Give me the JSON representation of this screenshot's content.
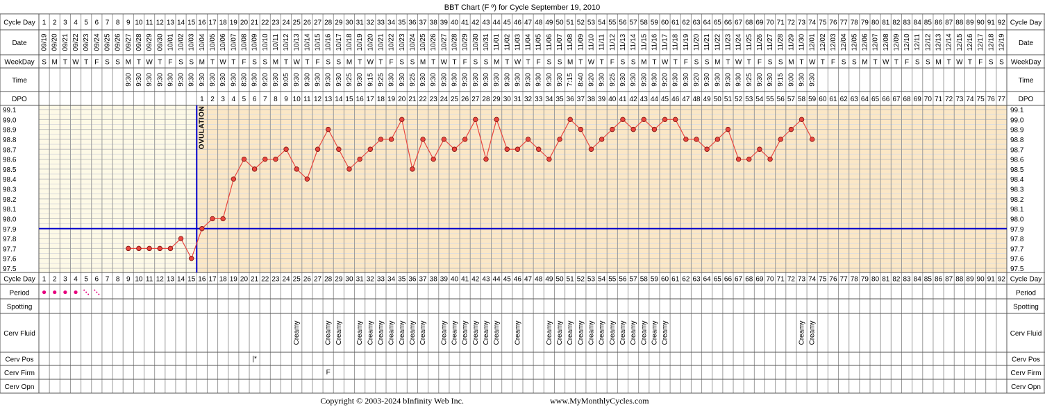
{
  "chart_data": {
    "type": "line",
    "title": "BBT Chart (F º) for Cycle September 19, 2010",
    "row_labels": {
      "cycle_day": "Cycle Day",
      "date": "Date",
      "weekday": "WeekDay",
      "time": "Time",
      "dpo": "DPO",
      "period": "Period",
      "spotting": "Spotting",
      "cerv_fluid": "Cerv Fluid",
      "cerv_pos": "Cerv Pos",
      "cerv_firm": "Cerv Firm",
      "cerv_opn": "Cerv Opn"
    },
    "cycle_days": [
      1,
      2,
      3,
      4,
      5,
      6,
      7,
      8,
      9,
      10,
      11,
      12,
      13,
      14,
      15,
      16,
      17,
      18,
      19,
      20,
      21,
      22,
      23,
      24,
      25,
      26,
      27,
      28,
      29,
      30,
      31,
      32,
      33,
      34,
      35,
      36,
      37,
      38,
      39,
      40,
      41,
      42,
      43,
      44,
      45,
      46,
      47,
      48,
      49,
      50,
      51,
      52,
      53,
      54,
      55,
      56,
      57,
      58,
      59,
      60,
      61,
      62,
      63,
      64,
      65,
      66,
      67,
      68,
      69,
      70,
      71,
      72,
      73,
      74,
      75,
      76,
      77,
      78,
      79,
      80,
      81,
      82,
      83,
      84,
      85,
      86,
      87,
      88,
      89,
      90,
      91,
      92
    ],
    "dates": [
      "09/19",
      "09/20",
      "09/21",
      "09/22",
      "09/23",
      "09/24",
      "09/25",
      "09/26",
      "09/27",
      "09/28",
      "09/29",
      "09/30",
      "10/01",
      "10/02",
      "10/03",
      "10/04",
      "10/05",
      "10/06",
      "10/07",
      "10/08",
      "10/09",
      "10/10",
      "10/11",
      "10/12",
      "10/13",
      "10/14",
      "10/15",
      "10/16",
      "10/17",
      "10/18",
      "10/19",
      "10/20",
      "10/21",
      "10/22",
      "10/23",
      "10/24",
      "10/25",
      "10/26",
      "10/27",
      "10/28",
      "10/29",
      "10/30",
      "10/31",
      "11/01",
      "11/02",
      "11/03",
      "11/04",
      "11/05",
      "11/06",
      "11/07",
      "11/08",
      "11/09",
      "11/10",
      "11/11",
      "11/12",
      "11/13",
      "11/14",
      "11/15",
      "11/16",
      "11/17",
      "11/18",
      "11/19",
      "11/20",
      "11/21",
      "11/22",
      "11/23",
      "11/24",
      "11/25",
      "11/26",
      "11/27",
      "11/28",
      "11/29",
      "11/30",
      "12/01",
      "12/02",
      "12/03",
      "12/04",
      "12/05",
      "12/06",
      "12/07",
      "12/08",
      "12/09",
      "12/10",
      "12/11",
      "12/12",
      "12/13",
      "12/14",
      "12/15",
      "12/16",
      "12/17",
      "12/18",
      "12/19"
    ],
    "weekdays": [
      "S",
      "M",
      "T",
      "W",
      "T",
      "F",
      "S",
      "S",
      "M",
      "T",
      "W",
      "T",
      "F",
      "S",
      "S",
      "M",
      "T",
      "W",
      "T",
      "F",
      "S",
      "S",
      "M",
      "T",
      "W",
      "T",
      "F",
      "S",
      "S",
      "M",
      "T",
      "W",
      "T",
      "F",
      "S",
      "S",
      "M",
      "T",
      "W",
      "T",
      "F",
      "S",
      "S",
      "M",
      "T",
      "W",
      "T",
      "F",
      "S",
      "S",
      "M",
      "T",
      "W",
      "T",
      "F",
      "S",
      "S",
      "M",
      "T",
      "W",
      "T",
      "F",
      "S",
      "S",
      "M",
      "T",
      "W",
      "T",
      "F",
      "S",
      "S",
      "M",
      "T",
      "W",
      "T",
      "F",
      "S",
      "S",
      "M",
      "T",
      "W",
      "T",
      "F",
      "S",
      "S",
      "M",
      "T",
      "W",
      "T",
      "F",
      "S",
      "S"
    ],
    "times": [
      "",
      "",
      "",
      "",
      "",
      "",
      "",
      "",
      "9:30",
      "9:30",
      "9:30",
      "9:30",
      "9:30",
      "9:30",
      "9:30",
      "9:30",
      "9:30",
      "9:30",
      "9:30",
      "8:30",
      "9:30",
      "9:20",
      "9:30",
      "9:05",
      "9:30",
      "9:30",
      "9:30",
      "9:30",
      "9:30",
      "9:25",
      "9:30",
      "9:15",
      "9:25",
      "9:30",
      "9:30",
      "9:25",
      "9:30",
      "9:30",
      "9:30",
      "9:30",
      "9:30",
      "9:30",
      "9:30",
      "9:30",
      "9:30",
      "9:30",
      "9:30",
      "9:30",
      "9:30",
      "9:30",
      "7:15",
      "8:40",
      "9:20",
      "9:30",
      "9:25",
      "9:30",
      "9:30",
      "9:30",
      "9:30",
      "9:20",
      "9:30",
      "9:30",
      "9:20",
      "9:30",
      "9:30",
      "9:30",
      "9:30",
      "9:25",
      "9:30",
      "9:30",
      "9:15",
      "9:00",
      "9:30",
      "9:30",
      "",
      "",
      "",
      "",
      "",
      "",
      "",
      "",
      "",
      "",
      "",
      "",
      "",
      "",
      "",
      "",
      "",
      ""
    ],
    "dpo": [
      "",
      "",
      "",
      "",
      "",
      "",
      "",
      "",
      "",
      "",
      "",
      "",
      "",
      "",
      "",
      "1",
      "2",
      "3",
      "4",
      "5",
      "6",
      "7",
      "8",
      "9",
      "10",
      "11",
      "12",
      "13",
      "14",
      "15",
      "16",
      "17",
      "18",
      "19",
      "20",
      "21",
      "22",
      "23",
      "24",
      "25",
      "26",
      "27",
      "28",
      "29",
      "30",
      "31",
      "32",
      "33",
      "34",
      "35",
      "36",
      "37",
      "38",
      "39",
      "40",
      "41",
      "42",
      "43",
      "44",
      "45",
      "46",
      "47",
      "48",
      "49",
      "50",
      "51",
      "52",
      "53",
      "54",
      "55",
      "56",
      "57",
      "58",
      "59",
      "60",
      "61",
      "62",
      "63",
      "64",
      "65",
      "66",
      "67",
      "68",
      "69",
      "70",
      "71",
      "72",
      "73",
      "74",
      "75",
      "76",
      "77"
    ],
    "y_ticks": [
      "99.1",
      "99.0",
      "98.9",
      "98.8",
      "98.7",
      "98.6",
      "98.5",
      "98.4",
      "98.3",
      "98.2",
      "98.1",
      "98.0",
      "97.9",
      "97.8",
      "97.7",
      "97.6",
      "97.5"
    ],
    "ylim": [
      97.5,
      99.1
    ],
    "temps": [
      null,
      null,
      null,
      null,
      null,
      null,
      null,
      null,
      97.7,
      97.7,
      97.7,
      97.7,
      97.7,
      97.8,
      97.6,
      97.9,
      98.0,
      98.0,
      98.4,
      98.6,
      98.5,
      98.6,
      98.6,
      98.7,
      98.5,
      98.4,
      98.7,
      98.9,
      98.7,
      98.5,
      98.6,
      98.7,
      98.8,
      98.8,
      99.0,
      98.5,
      98.8,
      98.6,
      98.8,
      98.7,
      98.8,
      99.0,
      98.6,
      99.0,
      98.7,
      98.7,
      98.8,
      98.7,
      98.6,
      98.8,
      99.0,
      98.9,
      98.7,
      98.8,
      98.9,
      99.0,
      98.9,
      99.0,
      98.9,
      99.0,
      99.0,
      98.8,
      98.8,
      98.7,
      98.8,
      98.9,
      98.6,
      98.6,
      98.7,
      98.6,
      98.8,
      98.9,
      99.0,
      98.8,
      null,
      null,
      null,
      null,
      null,
      null,
      null,
      null,
      null,
      null,
      null,
      null,
      null,
      null,
      null,
      null,
      null,
      null
    ],
    "coverline": 97.9,
    "ovulation_day": 15,
    "ovulation_label": "OVULATION",
    "period": [
      "dot",
      "dot",
      "dot",
      "dot",
      "light",
      "light",
      "",
      "",
      "",
      "",
      "",
      "",
      "",
      "",
      "",
      "",
      "",
      "",
      "",
      "",
      "",
      "",
      "",
      "",
      "",
      "",
      "",
      "",
      "",
      "",
      "",
      "",
      "",
      "",
      "",
      "",
      "",
      "",
      "",
      "",
      "",
      "",
      "",
      "",
      "",
      "",
      "",
      "",
      "",
      "",
      "",
      "",
      "",
      "",
      "",
      "",
      "",
      "",
      "",
      "",
      "",
      "",
      "",
      "",
      "",
      "",
      "",
      "",
      "",
      "",
      "",
      "",
      "",
      "",
      "",
      "",
      "",
      "",
      "",
      "",
      "",
      "",
      "",
      "",
      "",
      "",
      "",
      "",
      ""
    ],
    "cerv_fluid": [
      "",
      "",
      "",
      "",
      "",
      "",
      "",
      "",
      "",
      "",
      "",
      "",
      "",
      "",
      "",
      "",
      "",
      "",
      "",
      "",
      "",
      "",
      "",
      "",
      "Creamy",
      "",
      "",
      "Creamy",
      "Creamy",
      "",
      "Creamy",
      "Creamy",
      "Creamy",
      "Creamy",
      "Creamy",
      "Creamy",
      "Creamy",
      "",
      "Creamy",
      "Creamy",
      "Creamy",
      "Creamy",
      "Creamy",
      "Creamy",
      "",
      "Creamy",
      "",
      "",
      "Creamy",
      "Creamy",
      "Creamy",
      "Creamy",
      "Creamy",
      "Creamy",
      "Creamy",
      "Creamy",
      "Creamy",
      "Creamy",
      "Creamy",
      "Creamy",
      "",
      "",
      "",
      "",
      "",
      "",
      "",
      "",
      "",
      "",
      "",
      "",
      "Creamy",
      "Creamy",
      "",
      "",
      "",
      "",
      "",
      "",
      "",
      "",
      "",
      "",
      "",
      "",
      "",
      "",
      "",
      "",
      "",
      ""
    ],
    "cerv_pos": {
      "day": 21,
      "mark": "|*"
    },
    "cerv_firm": {
      "day": 28,
      "mark": "F"
    },
    "colors": {
      "pre_ovulation_bg": "#fdf9e6",
      "post_ovulation_bg": "#fbe7c6",
      "grid": "#c0c0c0",
      "line": "#e8473f",
      "marker": "#e8473f",
      "coverline": "#0000cc",
      "ovulation_line": "#0000cc",
      "period_dot": "#e6007e"
    }
  },
  "footer": {
    "copyright": "Copyright © 2003-2024 bInfinity Web Inc.",
    "url": "www.MyMonthlyCycles.com"
  }
}
